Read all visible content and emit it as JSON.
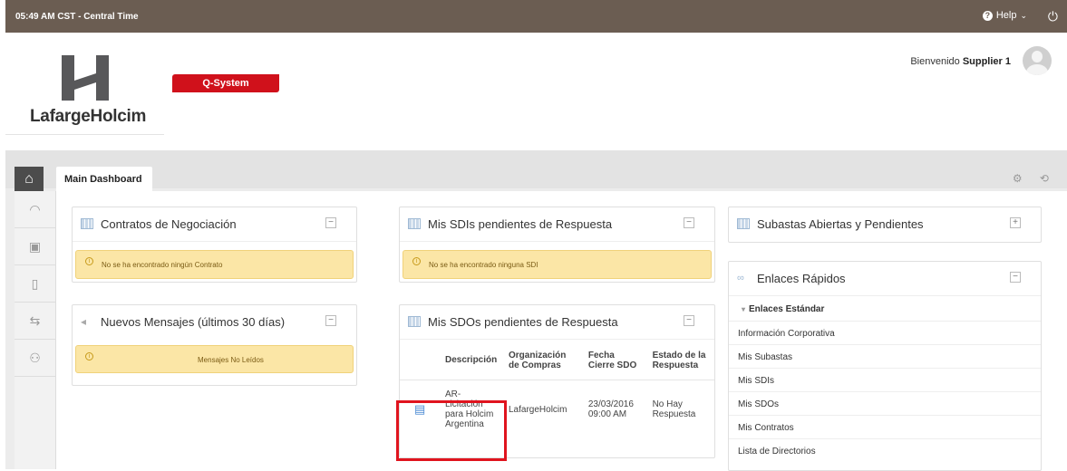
{
  "topbar": {
    "time": "05:49 AM CST - Central Time",
    "help": "Help",
    "help_caret": "⌄",
    "power_icon": "⏻"
  },
  "header": {
    "logo_text": "LafargeHolcim",
    "app_badge": "Q-System",
    "welcome_prefix": "Bienvenido",
    "welcome_user": "Supplier 1"
  },
  "tabs": {
    "home_icon": "⌂",
    "main_label": "Main Dashboard",
    "tools": "⚙ ⟲"
  },
  "sidenav": {
    "icons": [
      "◠",
      "▣",
      "▯",
      "⇆",
      "⚇"
    ]
  },
  "panels": {
    "contracts": {
      "title": "Contratos de Negociación",
      "btn": "−",
      "empty": "No se ha encontrado ningún Contrato"
    },
    "messages": {
      "title": "Nuevos Mensajes (últimos 30 días)",
      "btn": "−",
      "text": "Mensajes No Leídos"
    },
    "sdis": {
      "title": "Mis SDIs pendientes de Respuesta",
      "btn": "−",
      "empty": "No se ha encontrado ninguna SDI"
    },
    "sdos": {
      "title": "Mis SDOs pendientes de Respuesta",
      "btn": "−",
      "columns": [
        "",
        "Descripción",
        "Organización de Compras",
        "Fecha Cierre SDO",
        "Estado de la Respuesta"
      ],
      "rows": [
        {
          "description": "AR-Licitación para Holcim Argentina",
          "org": "LafargeHolcim",
          "date": "23/03/2016 09:00 AM",
          "status": "No Hay Respuesta"
        }
      ]
    },
    "auctions": {
      "title": "Subastas Abiertas y Pendientes",
      "btn": "+"
    },
    "quicklinks": {
      "title": "Enlaces Rápidos",
      "btn": "−",
      "section": "Enlaces Estándar",
      "links": [
        "Información Corporativa",
        "Mis Subastas",
        "Mis SDIs",
        "Mis SDOs",
        "Mis Contratos",
        "Lista de Directorios"
      ]
    }
  },
  "colors": {
    "topbar": "#6b5d52",
    "badge": "#d0111b",
    "alert": "#fbe6a6",
    "highlight": "#e0141e"
  }
}
